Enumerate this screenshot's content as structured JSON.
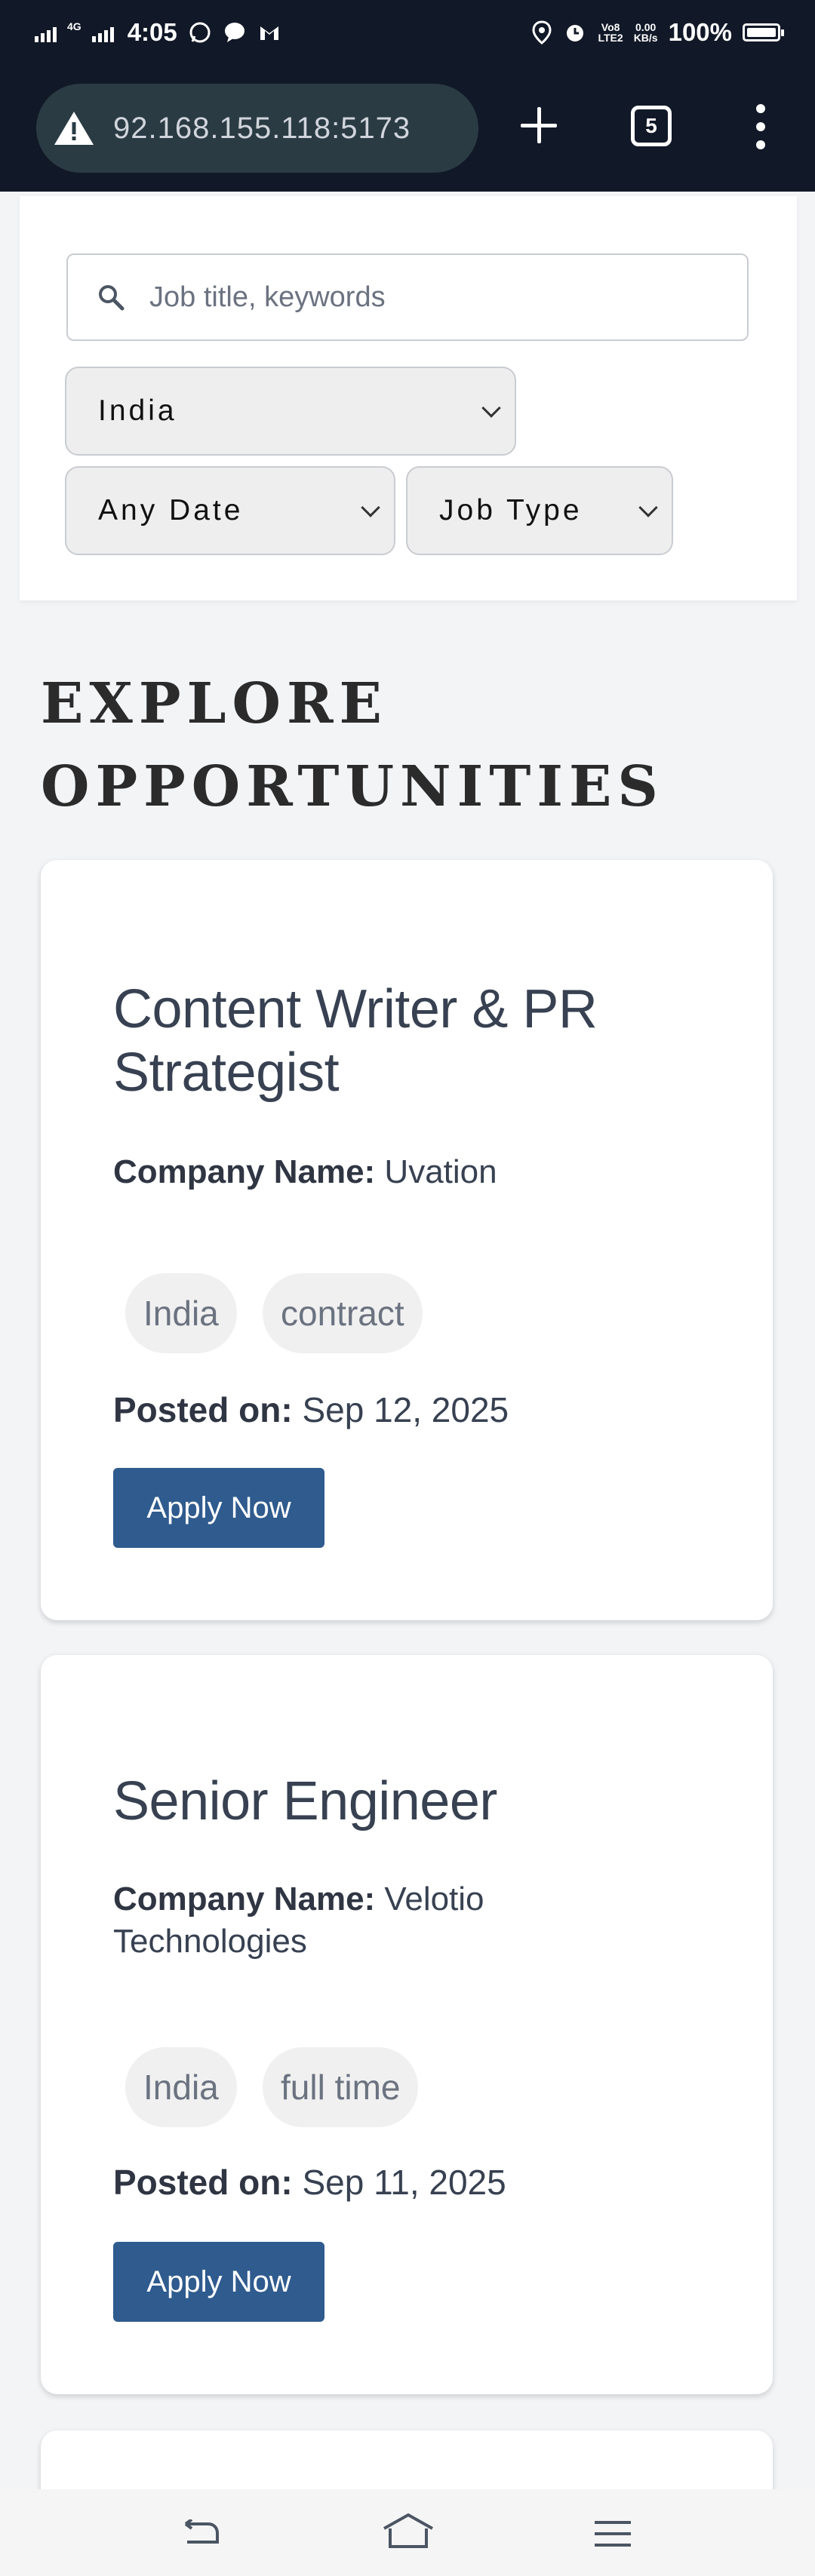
{
  "status_bar": {
    "time": "4:05",
    "network": "4G",
    "volte": "Vo8",
    "lte": "LTE2",
    "speed_value": "0.00",
    "speed_unit": "KB/s",
    "battery": "100%"
  },
  "browser": {
    "url": "92.168.155.118:5173",
    "tab_count": "5",
    "icons": [
      "warning-icon",
      "plus-icon",
      "tabs-icon",
      "more-icon"
    ]
  },
  "search": {
    "placeholder": "Job title, keywords",
    "location_selected": "India",
    "date_selected": "Any Date",
    "type_selected": "Job Type"
  },
  "section_title_line1": "EXPLORE",
  "section_title_line2": "OPPORTUNITIES",
  "jobs": [
    {
      "title": "Content Writer & PR Strategist",
      "company_label": "Company Name:",
      "company": "Uvation",
      "tags": [
        "India",
        "contract"
      ],
      "posted_label": "Posted on:",
      "posted": "Sep 12, 2025",
      "apply_label": "Apply Now"
    },
    {
      "title": "Senior Engineer",
      "company_label": "Company Name:",
      "company": "Velotio Technologies",
      "tags": [
        "India",
        "full time"
      ],
      "posted_label": "Posted on:",
      "posted": "Sep 11, 2025",
      "apply_label": "Apply Now"
    }
  ],
  "colors": {
    "status_bar_bg": "#111827",
    "url_pill_bg": "#2a3b44",
    "apply_button": "#2f5b8e",
    "page_bg": "#f3f4f6"
  }
}
